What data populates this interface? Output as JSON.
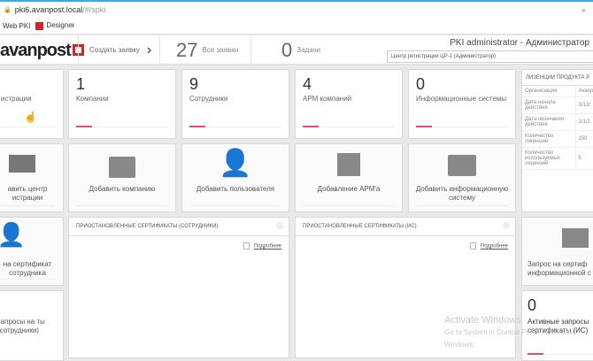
{
  "browser": {
    "url_host": "pki6.avanpost.local",
    "url_path": "/#/spki",
    "bookmarks": [
      "Web PKI",
      "Designer"
    ]
  },
  "header": {
    "logo": "avanpost",
    "create_label": "Создать заявку",
    "create_arrow": "›",
    "all_count": "27",
    "all_label": "Все заявки",
    "tasks_count": "0",
    "tasks_label": "Задачи",
    "user": "PKI administrator - Администратор",
    "rc_select": "Центр регистрации ЦР-1 (Администратор)"
  },
  "stats": [
    {
      "num": "",
      "label": "истрации"
    },
    {
      "num": "1",
      "label": "Компании"
    },
    {
      "num": "9",
      "label": "Сотрудники"
    },
    {
      "num": "4",
      "label": "АРМ компаний"
    },
    {
      "num": "0",
      "label": "Информационные системы"
    }
  ],
  "actions": [
    {
      "label": "авить центр истрации",
      "icon": "card-icon"
    },
    {
      "label": "Добавить компанию",
      "icon": "briefcase-icon"
    },
    {
      "label": "Добавить пользователя",
      "icon": "user-icon"
    },
    {
      "label": "Добавление АРМ'а",
      "icon": "floppy-upload-icon"
    },
    {
      "label": "Добавить информационную систему",
      "icon": "folder-icon"
    }
  ],
  "license": {
    "title": "ЛИЗЕНЦИИ ПРОДУКТА P",
    "rows": [
      [
        "Организация",
        "Avanp"
      ],
      [
        "Дата начала действия",
        "3/12/"
      ],
      [
        "Дата окончания действия",
        "1/1/2"
      ],
      [
        "Количество лицензий",
        "150"
      ],
      [
        "Количество используемых лицензий",
        "5"
      ]
    ]
  },
  "widgets": [
    {
      "title": "ПРИОСТАНОВЛЕННЫЕ СЕРТИФИКАТЫ (СОТРУДНИКИ)",
      "more": "Подробнее"
    },
    {
      "title": "ПРИОСТАНОВЛЕННЫЕ СЕРТИФИКАТЫ (ИС)",
      "more": "Подробнее"
    }
  ],
  "left_cards": {
    "cert_request": "на сертификат сотрудника",
    "active_requests": "запросы на ты (сотрудники)"
  },
  "right_cards": {
    "is_request": "Запрос на сертиф информационной с",
    "active_num": "0",
    "active_label": "Активные запросы сертификаты (ИС)"
  },
  "watermark": {
    "title": "Activate Windows",
    "sub": "Go to System in Control Panel to activate Windows."
  },
  "colors": {
    "accent": "#e0525f",
    "brand": "#d2232a"
  }
}
